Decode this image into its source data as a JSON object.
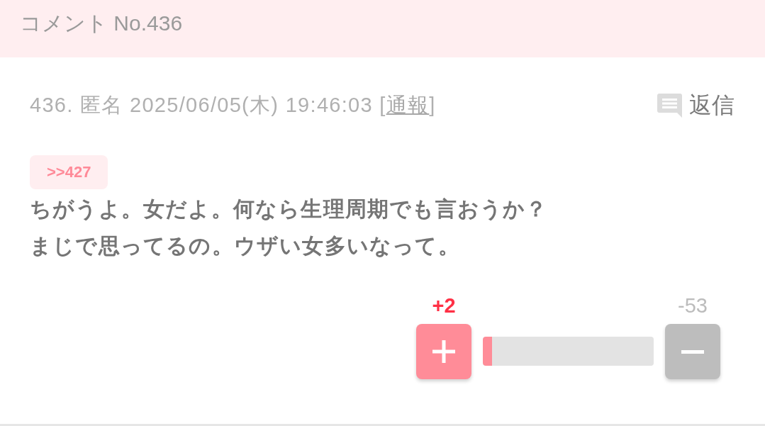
{
  "header": {
    "title": "コメント No.436"
  },
  "comment": {
    "meta": {
      "text_before": "436. 匿名 2025/06/05(木) 19:46:03 [",
      "report_link": "通報",
      "text_after": "]"
    },
    "reply_button": "返信",
    "anchor": ">>427",
    "body_lines": [
      "ちがうよ。女だよ。何なら生理周期でも言おうか？",
      "まじで思ってるの。ウザい女多いなって。"
    ]
  },
  "votes": {
    "plus_count": "+2",
    "minus_count": "-53",
    "level": 0.055
  }
}
